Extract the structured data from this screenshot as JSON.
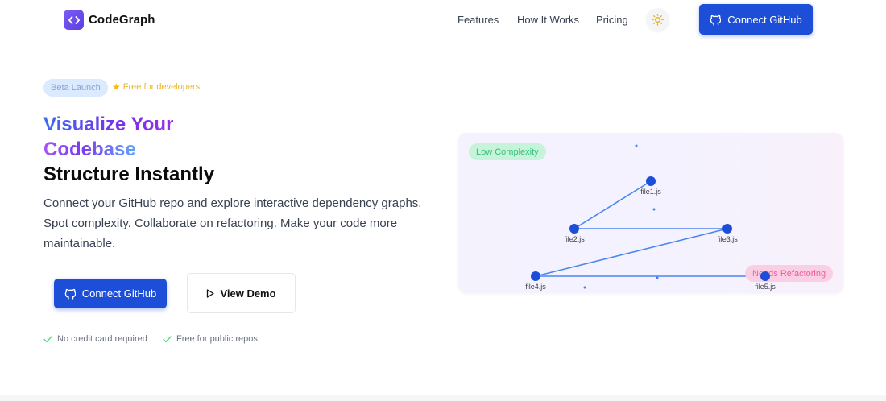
{
  "nav": {
    "brand": "CodeGraph",
    "links": [
      "Features",
      "How It Works",
      "Pricing"
    ],
    "cta": "Connect GitHub"
  },
  "hero": {
    "badge": "Beta Launch",
    "badge_note": "Free for developers",
    "title_line1": "Visualize Your",
    "title_line2": "Codebase",
    "title_line3": "Structure Instantly",
    "description": "Connect your GitHub repo and explore interactive dependency graphs. Spot complexity. Collaborate on refactoring. Make your code more maintainable.",
    "primary_cta": "Connect GitHub",
    "secondary_cta": "View Demo",
    "checks": [
      "No credit card required",
      "Free for public repos"
    ]
  },
  "graph": {
    "legend_low": "Low Complexity",
    "legend_high": "Needs Refactoring",
    "nodes": [
      "file1.js",
      "file2.js",
      "file3.js",
      "file4.js",
      "file5.js"
    ],
    "edges": [
      [
        "file2.js",
        "file1.js"
      ],
      [
        "file2.js",
        "file3.js"
      ],
      [
        "file4.js",
        "file3.js"
      ],
      [
        "file4.js",
        "file5.js"
      ]
    ]
  },
  "colors": {
    "primary": "#1d4ed8",
    "node": "#1d4ed8",
    "edge": "#4a86f0",
    "low_pill_bg": "#c6f3da",
    "high_pill_bg": "#fbcfe3",
    "accent_star": "#e9b52b"
  }
}
